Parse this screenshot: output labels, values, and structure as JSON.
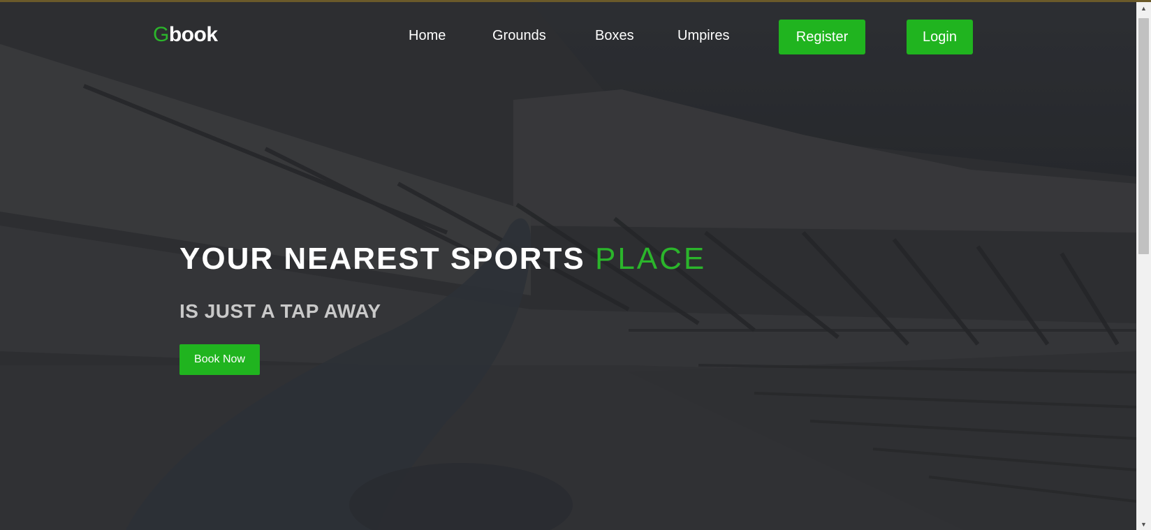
{
  "brand": {
    "logo_initial": "G",
    "logo_rest": "book",
    "accent_color": "#20b41f"
  },
  "nav": {
    "links": [
      "Home",
      "Grounds",
      "Boxes",
      "Umpires"
    ],
    "register_label": "Register",
    "login_label": "Login"
  },
  "hero": {
    "headline_main": "YOUR NEAREST SPORTS ",
    "headline_accent": "PLACE",
    "subheadline": "IS JUST A TAP AWAY",
    "cta_label": "Book Now"
  },
  "icons": {
    "scroll_up": "triangle-up-icon",
    "scroll_down": "triangle-down-icon"
  }
}
